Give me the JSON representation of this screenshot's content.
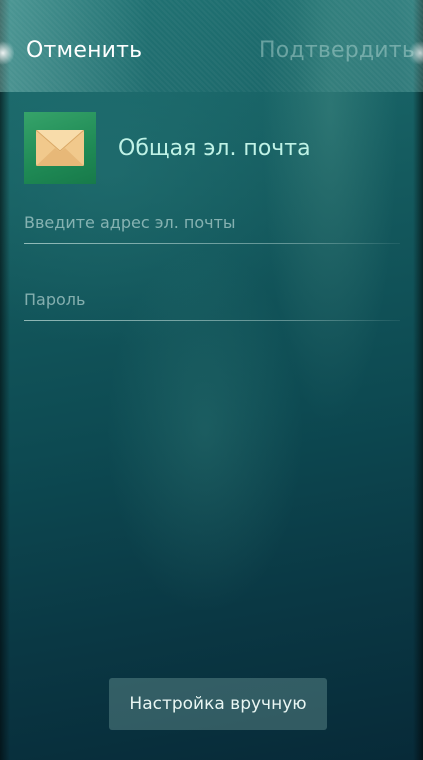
{
  "header": {
    "cancel_label": "Отменить",
    "confirm_label": "Подтвердить"
  },
  "account": {
    "icon": "envelope-icon",
    "title": "Общая эл. почта"
  },
  "form": {
    "email_placeholder": "Введите адрес эл. почты",
    "email_value": "",
    "password_placeholder": "Пароль",
    "password_value": ""
  },
  "footer": {
    "manual_setup_label": "Настройка вручную"
  },
  "colors": {
    "background_top": "#1d6f70",
    "background_bottom": "#072a38",
    "tile": "#1f8a55",
    "envelope": "#f1c98c",
    "title": "#bff2e6"
  }
}
